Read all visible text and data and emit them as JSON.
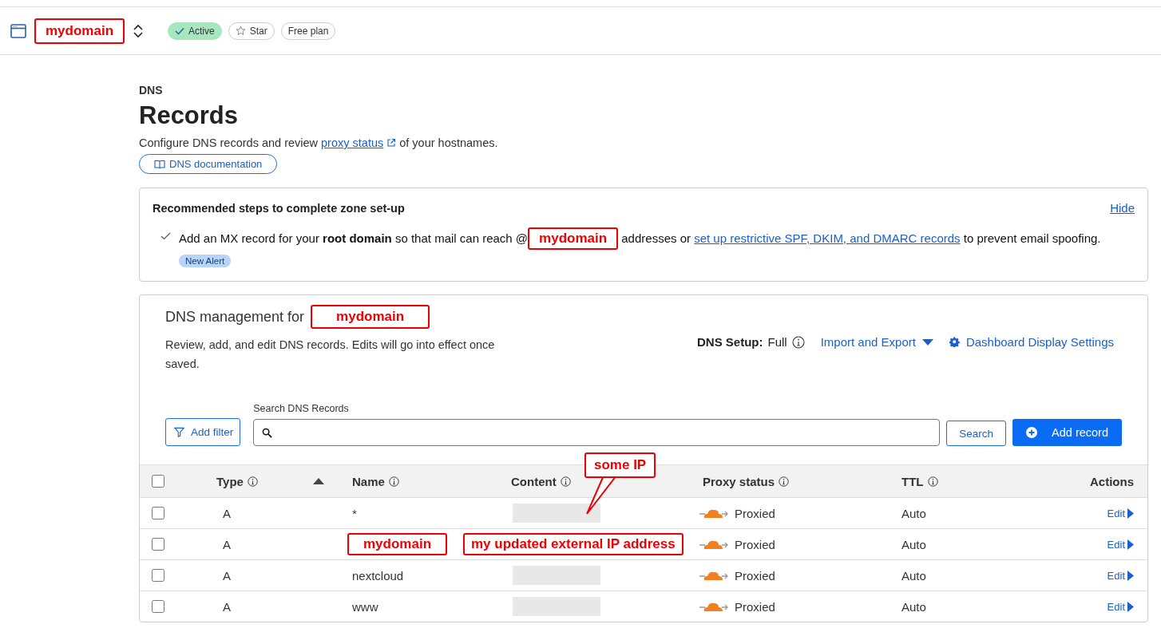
{
  "header": {
    "zone": "mydomain",
    "badges": [
      {
        "kind": "status",
        "label": "Active"
      },
      {
        "kind": "star",
        "label": "Star"
      },
      {
        "kind": "plan",
        "label": "Free plan"
      }
    ]
  },
  "page": {
    "section": "DNS",
    "title": "Records",
    "description_before": "Configure DNS records and review",
    "description_link": "proxy status",
    "description_after": "of your hostnames.",
    "doc_button": "DNS documentation"
  },
  "steps": {
    "title": "Recommended steps to complete zone set-up",
    "hide": "Hide",
    "items": [
      {
        "done": true,
        "before": "Add an MX record for your **root domain** so that mail can reach @",
        "redacted": "mydomain",
        "middle": "addresses or",
        "link": "set up restrictive SPF, DKIM, and DMARC records",
        "after": "to prevent email spoofing.",
        "badge": "New Alert"
      }
    ]
  },
  "management": {
    "title": "DNS management for",
    "zone": "mydomain",
    "subtitle": "Review, add, and edit DNS records. Edits will go into effect once saved.",
    "setup_label": "DNS Setup:",
    "setup_value": "Full",
    "import_export": "Import and Export",
    "display_settings": "Dashboard Display Settings",
    "search_label": "Search DNS Records",
    "add_filter": "Add filter",
    "search_button": "Search",
    "add_record": "Add record"
  },
  "table": {
    "all_selected": false,
    "callout": "some IP",
    "columns": [
      {
        "label": "Type",
        "info": true,
        "sorted": true
      },
      {
        "label": "Name",
        "info": true,
        "sorted": false
      },
      {
        "label": "Content",
        "info": true,
        "sorted": false
      },
      {
        "label": "Proxy status",
        "info": true,
        "sorted": false
      },
      {
        "label": "TTL",
        "info": true,
        "sorted": false
      },
      {
        "label": "Actions",
        "info": false,
        "sorted": false
      }
    ],
    "rows": [
      {
        "selected": false,
        "type": "A",
        "name": {
          "kind": "text",
          "text": "*"
        },
        "content": {
          "kind": "redacted"
        },
        "proxied": true,
        "proxy": "Proxied",
        "ttl": "Auto",
        "action": "Edit"
      },
      {
        "selected": false,
        "type": "A",
        "name": {
          "kind": "annotation",
          "text": "mydomain"
        },
        "content": {
          "kind": "annotation",
          "text": "my updated external IP address"
        },
        "proxied": true,
        "proxy": "Proxied",
        "ttl": "Auto",
        "action": "Edit"
      },
      {
        "selected": false,
        "type": "A",
        "name": {
          "kind": "text",
          "text": "nextcloud"
        },
        "content": {
          "kind": "redacted"
        },
        "proxied": true,
        "proxy": "Proxied",
        "ttl": "Auto",
        "action": "Edit"
      },
      {
        "selected": false,
        "type": "A",
        "name": {
          "kind": "text",
          "text": "www"
        },
        "content": {
          "kind": "redacted"
        },
        "proxied": true,
        "proxy": "Proxied",
        "ttl": "Auto",
        "action": "Edit"
      }
    ]
  }
}
